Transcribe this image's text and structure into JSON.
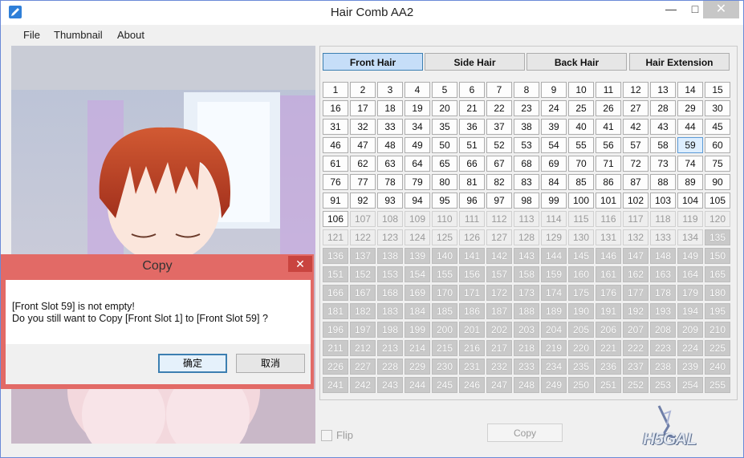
{
  "window": {
    "title": "Hair Comb AA2",
    "close_glyph": "✕",
    "minimize_glyph": "—",
    "maximize_glyph": "□"
  },
  "menu": {
    "file": "File",
    "thumbnail": "Thumbnail",
    "about": "About"
  },
  "tabs": [
    {
      "label": "Front Hair",
      "active": true
    },
    {
      "label": "Side Hair",
      "active": false
    },
    {
      "label": "Back Hair",
      "active": false
    },
    {
      "label": "Hair Extension",
      "active": false
    }
  ],
  "slots": {
    "count": 255,
    "filled_through": 106,
    "disabled_from": 135,
    "selected": 59
  },
  "controls": {
    "flip_label": "Flip",
    "copy_label": "Copy"
  },
  "watermark": {
    "text": "H5GAL"
  },
  "dialog": {
    "title": "Copy",
    "close_glyph": "✕",
    "line1": "[Front Slot 59] is not empty!",
    "line2": "Do you still want to Copy [Front Slot 1] to [Front Slot 59] ?",
    "ok_label": "确定",
    "cancel_label": "取消"
  },
  "colors": {
    "dialog_frame": "#e26a66",
    "active_tab": "#c6def8",
    "accent": "#3c7fb1"
  }
}
